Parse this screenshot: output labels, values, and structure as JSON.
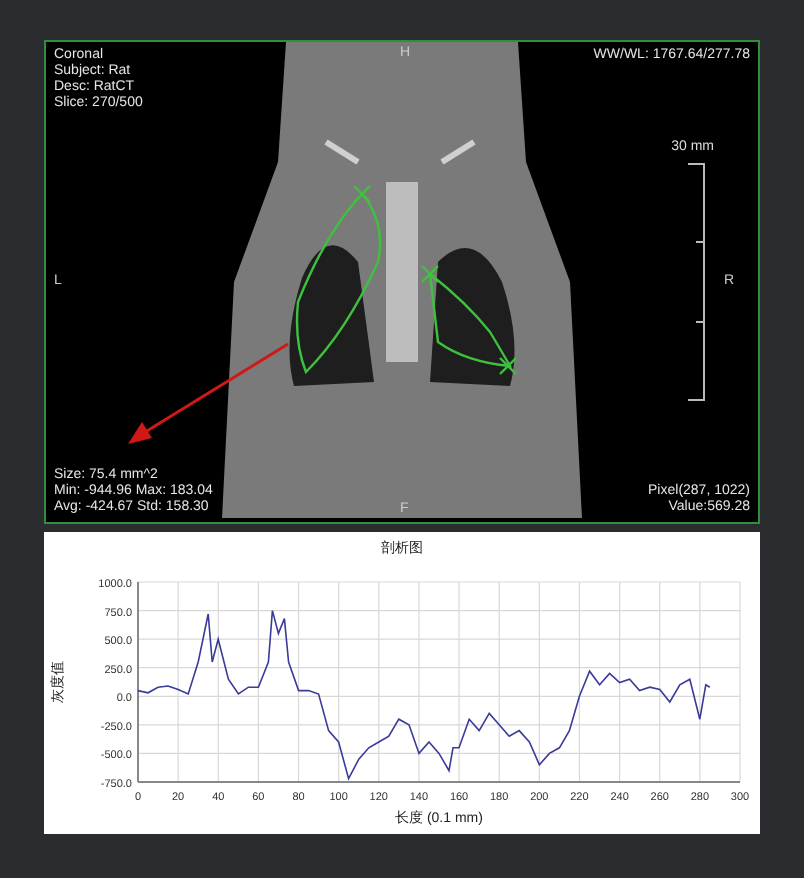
{
  "viewer": {
    "info_lines": [
      "Coronal",
      "Subject: Rat",
      "Desc: RatCT",
      "Slice: 270/500"
    ],
    "window_level": "WW/WL: 1767.64/277.78",
    "orientation": {
      "top": "H",
      "bottom": "F",
      "left": "L",
      "right": "R"
    },
    "scale_label": "30 mm",
    "roi_stats": [
      "Size: 75.4 mm^2",
      "Min: -944.96 Max: 183.04",
      "Avg: -424.67 Std: 158.30"
    ],
    "pixel_info": [
      "Pixel(287, 1022)",
      "Value:569.28"
    ]
  },
  "profile": {
    "chart_data": {
      "type": "line",
      "title": "剖析图",
      "xlabel": "长度 (0.1 mm)",
      "ylabel": "灰度值",
      "x": [
        0,
        5,
        10,
        15,
        20,
        25,
        30,
        35,
        37,
        40,
        45,
        50,
        55,
        60,
        65,
        67,
        70,
        73,
        75,
        80,
        85,
        90,
        95,
        100,
        105,
        110,
        115,
        120,
        125,
        130,
        135,
        140,
        145,
        150,
        155,
        157,
        160,
        165,
        170,
        175,
        180,
        185,
        190,
        195,
        200,
        205,
        210,
        215,
        220,
        225,
        230,
        235,
        240,
        245,
        250,
        255,
        260,
        265,
        270,
        275,
        280,
        283,
        285
      ],
      "series": [
        {
          "color": "#3a3a9a",
          "values": [
            50,
            30,
            80,
            90,
            60,
            20,
            300,
            720,
            300,
            500,
            150,
            20,
            80,
            80,
            300,
            750,
            550,
            680,
            300,
            50,
            50,
            20,
            -300,
            -400,
            -720,
            -550,
            -450,
            -400,
            -350,
            -200,
            -250,
            -500,
            -400,
            -500,
            -650,
            -450,
            -450,
            -200,
            -300,
            -150,
            -250,
            -350,
            -300,
            -400,
            -600,
            -500,
            -450,
            -300,
            0,
            220,
            100,
            200,
            120,
            150,
            50,
            80,
            60,
            -50,
            100,
            150,
            -200,
            100,
            80
          ]
        }
      ],
      "grid": true,
      "xlim": [
        0,
        300
      ],
      "ylim": [
        -750,
        1000
      ],
      "xticks": [
        0,
        20,
        40,
        60,
        80,
        100,
        120,
        140,
        160,
        180,
        200,
        220,
        240,
        260,
        280,
        300
      ],
      "yticks": [
        {
          "value": 1000,
          "label": "1000.0"
        },
        {
          "value": 750,
          "label": "750.0"
        },
        {
          "value": 500,
          "label": "500.0"
        },
        {
          "value": 250,
          "label": "250.0"
        },
        {
          "value": 0,
          "label": "0.0"
        },
        {
          "value": -250,
          "label": "-250.0"
        },
        {
          "value": -500,
          "label": "-500.0"
        },
        {
          "value": -750,
          "label": "-750.0"
        }
      ]
    }
  }
}
